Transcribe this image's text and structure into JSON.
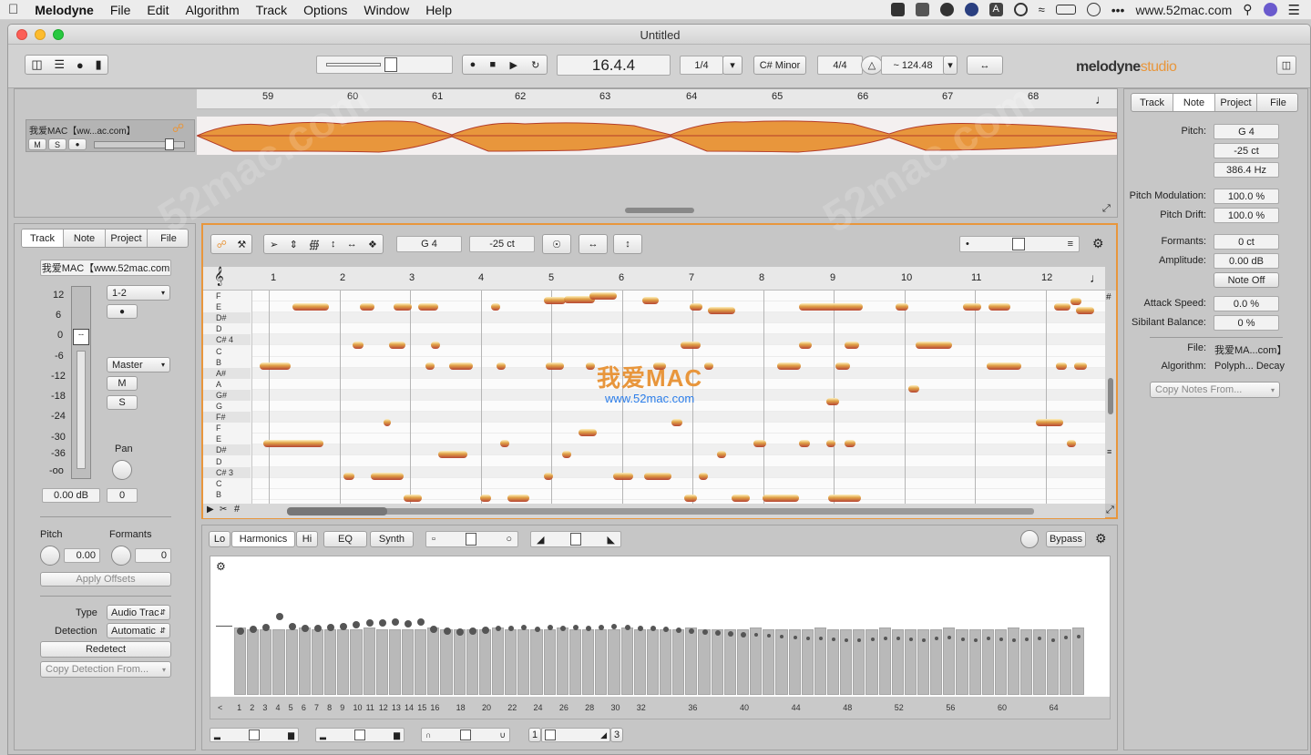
{
  "menubar": {
    "apple": "",
    "app": "Melodyne",
    "items": [
      "File",
      "Edit",
      "Algorithm",
      "Track",
      "Options",
      "Window",
      "Help"
    ],
    "site": "www.52mac.com"
  },
  "window": {
    "title": "Untitled"
  },
  "toolbar": {
    "position": "16.4.4",
    "quant": "1/4",
    "key": "C# Minor",
    "meter": "4/4",
    "tempo": "~ 124.48",
    "brand": "melodyne",
    "brand_suffix": "studio"
  },
  "arrange": {
    "track_name": "我爱MAC【ww...ac.com】",
    "m": "M",
    "s": "S",
    "ticks": [
      "59",
      "60",
      "61",
      "62",
      "63",
      "64",
      "65",
      "66",
      "67",
      "68"
    ]
  },
  "left": {
    "tabs": [
      "Track",
      "Note",
      "Project",
      "File"
    ],
    "track_name": "我爱MAC【www.52mac.com",
    "scale": [
      "12",
      "6",
      "0",
      "-6",
      "-12",
      "-18",
      "-24",
      "-30",
      "-36",
      "-oo"
    ],
    "io": "1-2",
    "output": "Master",
    "m": "M",
    "s": "S",
    "pan_label": "Pan",
    "gain": "0.00 dB",
    "pan_val": "0",
    "pitch_label": "Pitch",
    "formants_label": "Formants",
    "pitch_val": "0.00",
    "formants_val": "0",
    "apply": "Apply Offsets",
    "type_label": "Type",
    "type_val": "Audio Trac",
    "detect_label": "Detection",
    "detect_val": "Automatic",
    "redetect": "Redetect",
    "copy_detect": "Copy Detection From..."
  },
  "editor": {
    "pitch": "G 4",
    "cents": "-25 ct",
    "bars": [
      "1",
      "2",
      "3",
      "4",
      "5",
      "6",
      "7",
      "8",
      "9",
      "10",
      "11",
      "12"
    ],
    "keys": [
      "F",
      "E",
      "D#",
      "D",
      "C# 4",
      "C",
      "B",
      "A#",
      "A",
      "G#",
      "G",
      "F#",
      "F",
      "E",
      "D#",
      "D",
      "C# 3",
      "C",
      "B"
    ]
  },
  "watermark": {
    "title": "我爱MAC",
    "url": "www.52mac.com"
  },
  "sound": {
    "tabs": [
      "Lo",
      "Harmonics",
      "Hi",
      "EQ",
      "Synth"
    ],
    "bypass": "Bypass",
    "numbers": [
      "<",
      "1",
      "2",
      "3",
      "4",
      "5",
      "6",
      "7",
      "8",
      "9",
      "10",
      "11",
      "12",
      "13",
      "14",
      "15",
      "16",
      "18",
      "20",
      "22",
      "24",
      "26",
      "28",
      "30",
      "32",
      "36",
      "40",
      "44",
      "48",
      "52",
      "56",
      "60",
      "64"
    ],
    "range_start": "1",
    "range_end": "3"
  },
  "inspector": {
    "tabs": [
      "Track",
      "Note",
      "Project",
      "File"
    ],
    "rows": [
      {
        "label": "Pitch:",
        "value": "G 4"
      },
      {
        "label": "",
        "value": "-25 ct"
      },
      {
        "label": "",
        "value": "386.4 Hz"
      },
      {
        "label": "Pitch Modulation:",
        "value": "100.0 %"
      },
      {
        "label": "Pitch Drift:",
        "value": "100.0 %"
      },
      {
        "label": "Formants:",
        "value": "0 ct"
      },
      {
        "label": "Amplitude:",
        "value": "0.00 dB"
      },
      {
        "label": "",
        "value": "Note Off"
      },
      {
        "label": "Attack Speed:",
        "value": "0.0 %"
      },
      {
        "label": "Sibilant Balance:",
        "value": "0 %"
      }
    ],
    "file_label": "File:",
    "file_val": "我爱MA...com】",
    "algo_label": "Algorithm:",
    "algo_val": "Polyph... Decay",
    "copy_notes": "Copy Notes From..."
  },
  "colors": {
    "note_top": "#fff2c0",
    "note_mid": "#e0a040",
    "note_bottom": "#b33c2a",
    "accent": "#e8963c"
  }
}
